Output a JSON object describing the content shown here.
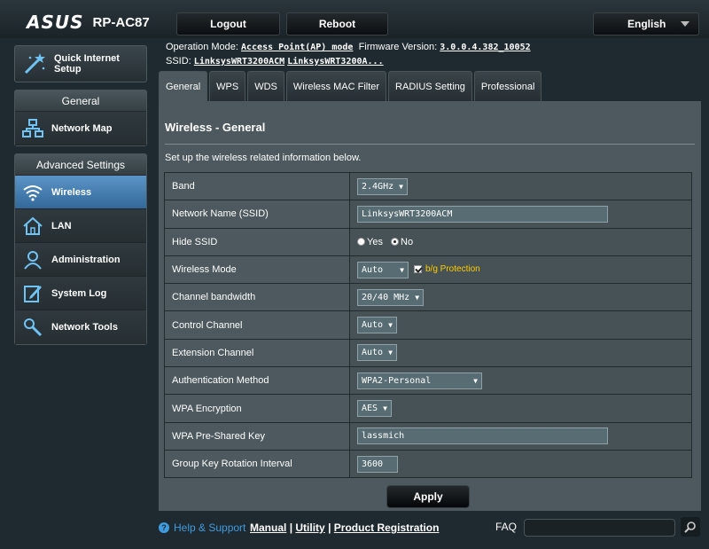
{
  "header": {
    "brand": "ASUS",
    "model": "RP-AC87",
    "logout_label": "Logout",
    "reboot_label": "Reboot",
    "language": "English"
  },
  "info": {
    "operation_mode_label": "Operation Mode:",
    "operation_mode_value": "Access Point(AP) mode",
    "firmware_label": "Firmware Version:",
    "firmware_value": "3.0.0.4.382_10052",
    "ssid_label": "SSID:",
    "ssid_values": [
      "LinksysWRT3200ACM",
      "LinksysWRT3200A..."
    ]
  },
  "sidebar": {
    "quick_setup": "Quick Internet Setup",
    "general_header": "General",
    "general_items": [
      {
        "label": "Network Map",
        "icon": "network-map-icon"
      }
    ],
    "advanced_header": "Advanced Settings",
    "advanced_items": [
      {
        "label": "Wireless",
        "icon": "wireless-icon",
        "active": true
      },
      {
        "label": "LAN",
        "icon": "home-icon"
      },
      {
        "label": "Administration",
        "icon": "user-icon"
      },
      {
        "label": "System Log",
        "icon": "log-icon"
      },
      {
        "label": "Network Tools",
        "icon": "tools-icon"
      }
    ]
  },
  "tabs": [
    "General",
    "WPS",
    "WDS",
    "Wireless MAC Filter",
    "RADIUS Setting",
    "Professional"
  ],
  "panel": {
    "title": "Wireless - General",
    "description": "Set up the wireless related information below."
  },
  "settings": {
    "band": {
      "label": "Band",
      "value": "2.4GHz"
    },
    "ssid": {
      "label": "Network Name (SSID)",
      "value": "LinksysWRT3200ACM"
    },
    "hide_ssid": {
      "label": "Hide SSID",
      "yes": "Yes",
      "no": "No"
    },
    "wireless_mode": {
      "label": "Wireless Mode",
      "value": "Auto",
      "protection_label": "b/g Protection"
    },
    "channel_bandwidth": {
      "label": "Channel bandwidth",
      "value": "20/40 MHz"
    },
    "control_channel": {
      "label": "Control Channel",
      "value": "Auto"
    },
    "extension_channel": {
      "label": "Extension Channel",
      "value": "Auto"
    },
    "auth_method": {
      "label": "Authentication Method",
      "value": "WPA2-Personal"
    },
    "wpa_encryption": {
      "label": "WPA Encryption",
      "value": "AES"
    },
    "wpa_key": {
      "label": "WPA Pre-Shared Key",
      "value": "lassmich"
    },
    "group_key": {
      "label": "Group Key Rotation Interval",
      "value": "3600"
    }
  },
  "apply_label": "Apply",
  "footer": {
    "help": "Help & Support",
    "manual": "Manual",
    "utility": "Utility",
    "registration": "Product Registration",
    "separator": "|",
    "faq": "FAQ"
  },
  "colors": {
    "accent_blue": "#4a86bd",
    "warning_yellow": "#ffcc00",
    "help_blue": "#3f9ce0"
  }
}
